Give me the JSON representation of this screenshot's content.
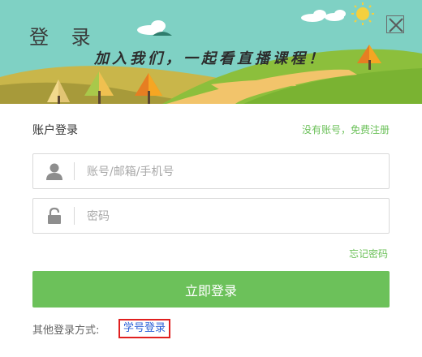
{
  "header": {
    "title": "登 录",
    "slogan": "加入我们，一起看直播课程！"
  },
  "form": {
    "account_login_title": "账户登录",
    "register_link": "没有账号，免费注册",
    "username_placeholder": "账号/邮箱/手机号",
    "password_placeholder": "密码",
    "forgot_password": "忘记密码",
    "login_button": "立即登录"
  },
  "other_login": {
    "label": "其他登录方式:",
    "student_id_login": "学号登录"
  },
  "icons": {
    "close": "close-icon",
    "user": "user-icon",
    "lock": "lock-icon"
  },
  "colors": {
    "accent_green": "#6cc15a",
    "sky": "#7fd1c4",
    "highlight_border": "#e02020",
    "link_blue": "#2b5fd6"
  }
}
